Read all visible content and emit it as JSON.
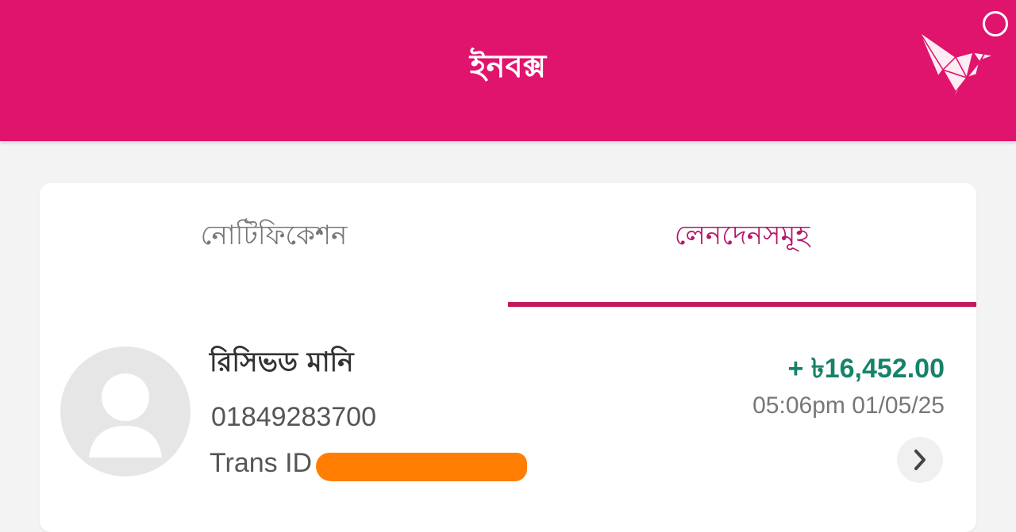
{
  "header": {
    "title": "ইনবক্স",
    "colors": {
      "background": "#e0146d",
      "text": "#ffffff"
    },
    "logo_icon": "origami-bird-icon",
    "status_icon": "circle-icon"
  },
  "tabs": [
    {
      "label": "নোটিফিকেশন",
      "active": false
    },
    {
      "label": "লেনদেনসমূহ",
      "active": true
    }
  ],
  "accent_color": "#c4185e",
  "transaction": {
    "type_label": "রিসিভড মানি",
    "number": "01849283700",
    "trans_id_label": "Trans ID",
    "amount": "+ ৳16,452.00",
    "amount_color": "#16826a",
    "datetime": "05:06pm 01/05/25",
    "avatar_icon": "user-placeholder-icon",
    "details_icon": "chevron-right-icon"
  }
}
